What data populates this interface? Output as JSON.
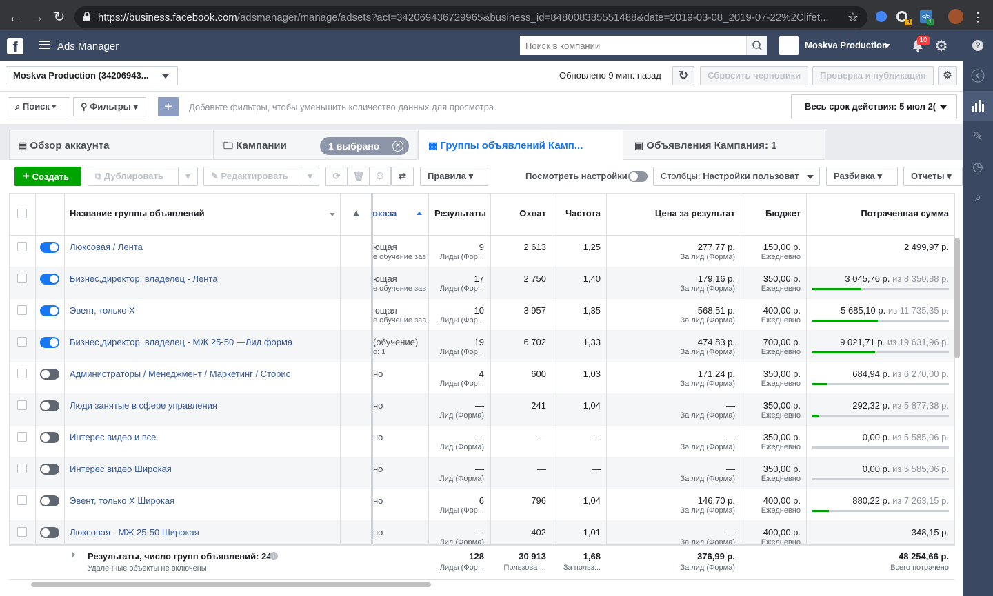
{
  "browser": {
    "url_host": "https://business.facebook.com",
    "url_path": "/adsmanager/manage/adsets?act=342069436729965&business_id=848008385551488&date=2019-03-08_2019-07-22%2Clifet...",
    "ext_badge_1": "3",
    "ext_badge_2": "1"
  },
  "topbar": {
    "logo": "f",
    "app_title": "Ads Manager",
    "search_placeholder": "Поиск в компании",
    "account_name": "Moskva Production",
    "notif_count": "10"
  },
  "toolbar": {
    "account_select": "Moskva Production (34206943...",
    "updated": "Обновлено 9 мин. назад",
    "reset_drafts": "Сбросить черновики",
    "review_publish": "Проверка и публикация"
  },
  "filterbar": {
    "search": "Поиск",
    "filters": "Фильтры",
    "hint": "Добавьте фильтры, чтобы уменьшить количество данных для просмотра.",
    "daterange": "Весь срок действия: 5 июл 2("
  },
  "tabs": {
    "overview": "Обзор аккаунта",
    "campaigns": "Кампании",
    "selected": "1 выбрано",
    "adsets": "Группы объявлений Камп...",
    "ads": "Объявления Кампания: 1"
  },
  "actions": {
    "create": "Создать",
    "duplicate": "Дублировать",
    "edit": "Редактировать",
    "rules": "Правила",
    "view_settings": "Посмотреть настройки",
    "columns_label": "Столбцы:",
    "columns_value": "Настройки пользоват",
    "breakdown": "Разбивка",
    "reports": "Отчеты"
  },
  "table": {
    "headers": {
      "name": "Название группы объявлений",
      "delivery": "оказа",
      "results": "Результаты",
      "reach": "Охват",
      "frequency": "Частота",
      "cost": "Цена за результат",
      "budget": "Бюджет",
      "spent": "Потраченная сумма"
    },
    "rows": [
      {
        "name": "Люксовая / Лента",
        "on": true,
        "delivery": "ющая",
        "delivery_sub": "е обучение зав",
        "results": "9",
        "results_sub": "Лиды (Фор...",
        "reach": "2 613",
        "freq": "1,25",
        "cost": "277,77 р.",
        "cost_sub": "За лид (Форма)",
        "budget": "150,00 р.",
        "budget_sub": "Ежедневно",
        "spent": "2 499,97 р.",
        "spent_of": "",
        "progress": null
      },
      {
        "name": "Бизнес,директор, владелец - Лента",
        "on": true,
        "delivery": "ющая",
        "delivery_sub": "е обучение зав",
        "results": "17",
        "results_sub": "Лиды (Фор...",
        "reach": "2 750",
        "freq": "1,40",
        "cost": "179,16 р.",
        "cost_sub": "За лид (Форма)",
        "budget": "350,00 р.",
        "budget_sub": "Ежедневно",
        "spent": "3 045,76 р.",
        "spent_of": "из 8 350,88 р.",
        "progress": 0.36
      },
      {
        "name": "Эвент, только Х",
        "on": true,
        "delivery": "ющая",
        "delivery_sub": "е обучение зав",
        "results": "10",
        "results_sub": "Лиды (Фор...",
        "reach": "3 957",
        "freq": "1,35",
        "cost": "568,51 р.",
        "cost_sub": "За лид (Форма)",
        "budget": "400,00 р.",
        "budget_sub": "Ежедневно",
        "spent": "5 685,10 р.",
        "spent_of": "из 11 735,35 р.",
        "progress": 0.48
      },
      {
        "name": "Бизнес,директор, владелец - МЖ 25-50 —Лид форма",
        "on": true,
        "delivery": " (обучение)",
        "delivery_sub": "о: 1",
        "results": "19",
        "results_sub": "Лиды (Фор...",
        "reach": "6 702",
        "freq": "1,33",
        "cost": "474,83 р.",
        "cost_sub": "За лид (Форма)",
        "budget": "700,00 р.",
        "budget_sub": "Ежедневно",
        "spent": "9 021,71 р.",
        "spent_of": "из 19 631,96 р.",
        "progress": 0.46
      },
      {
        "name": "Администраторы / Менеджмент / Маркетинг / Сторис",
        "on": false,
        "delivery": "но",
        "delivery_sub": "",
        "results": "4",
        "results_sub": "Лиды (Фор...",
        "reach": "600",
        "freq": "1,03",
        "cost": "171,24 р.",
        "cost_sub": "За лид (Форма)",
        "budget": "350,00 р.",
        "budget_sub": "Ежедневно",
        "spent": "684,94 р.",
        "spent_of": "из 6 270,00 р.",
        "progress": 0.11
      },
      {
        "name": "Люди занятые в сфере управления",
        "on": false,
        "delivery": "но",
        "delivery_sub": "",
        "results": "—",
        "results_sub": "Лид (Форма)",
        "reach": "241",
        "freq": "1,04",
        "cost": "—",
        "cost_sub": "За лид (Форма)",
        "budget": "350,00 р.",
        "budget_sub": "Ежедневно",
        "spent": "292,32 р.",
        "spent_of": "из 5 877,38 р.",
        "progress": 0.05
      },
      {
        "name": "Интерес видео и все",
        "on": false,
        "delivery": "но",
        "delivery_sub": "",
        "results": "—",
        "results_sub": "Лид (Форма)",
        "reach": "—",
        "freq": "—",
        "cost": "—",
        "cost_sub": "За лид (Форма)",
        "budget": "350,00 р.",
        "budget_sub": "Ежедневно",
        "spent": "0,00 р.",
        "spent_of": "из 5 585,06 р.",
        "progress": 0
      },
      {
        "name": "Интерес видео Широкая",
        "on": false,
        "delivery": "но",
        "delivery_sub": "",
        "results": "—",
        "results_sub": "Лид (Форма)",
        "reach": "—",
        "freq": "—",
        "cost": "—",
        "cost_sub": "За лид (Форма)",
        "budget": "350,00 р.",
        "budget_sub": "Ежедневно",
        "spent": "0,00 р.",
        "spent_of": "из 5 585,06 р.",
        "progress": 0
      },
      {
        "name": "Эвент, только Х Широкая",
        "on": false,
        "delivery": "но",
        "delivery_sub": "",
        "results": "6",
        "results_sub": "Лиды (Фор...",
        "reach": "796",
        "freq": "1,04",
        "cost": "146,70 р.",
        "cost_sub": "За лид (Форма)",
        "budget": "400,00 р.",
        "budget_sub": "Ежедневно",
        "spent": "880,22 р.",
        "spent_of": "из 7 263,15 р.",
        "progress": 0.12
      },
      {
        "name": "Люксовая - МЖ 25-50 Широкая",
        "on": false,
        "delivery": "но",
        "delivery_sub": "",
        "results": "—",
        "results_sub": "Лид (Форма)",
        "reach": "402",
        "freq": "1,01",
        "cost": "—",
        "cost_sub": "За лид (Форма)",
        "budget": "400,00 р.",
        "budget_sub": "Ежедневно",
        "spent": "348,15 р.",
        "spent_of": "",
        "progress": null
      }
    ],
    "footer": {
      "title": "Результаты, число групп объявлений: 24",
      "note": "Удаленные объекты не включены",
      "results": "128",
      "results_sub": "Лиды (Фор...",
      "reach": "30 913",
      "reach_sub": "Пользоват...",
      "freq": "1,68",
      "freq_sub": "За польз...",
      "cost": "376,99 р.",
      "cost_sub": "За лид (Форма)",
      "spent": "48 254,66 р.",
      "spent_sub": "Всего потрачено"
    }
  },
  "colors": {
    "accent": "#1877f2",
    "create": "#00a400",
    "topbar": "#3b4861",
    "link": "#385898"
  }
}
